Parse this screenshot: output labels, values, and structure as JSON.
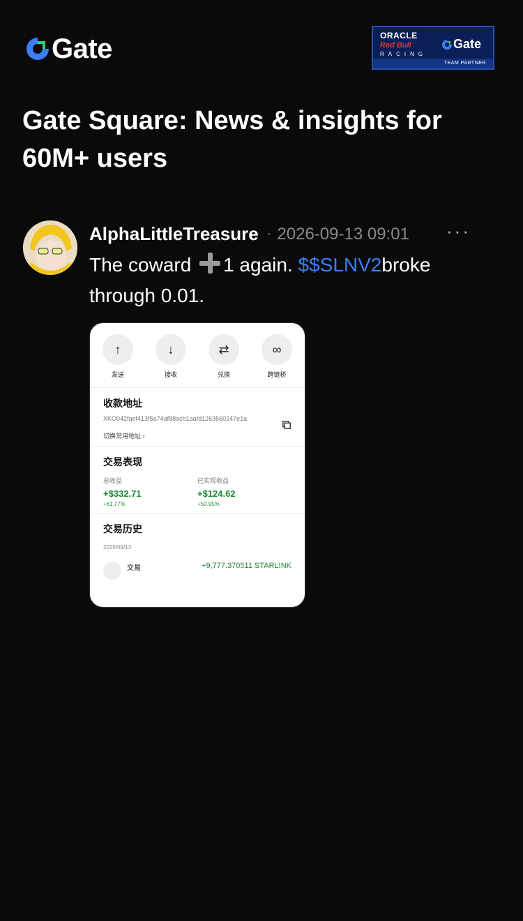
{
  "brand": {
    "name": "Gate",
    "accent": "#3a7ff6",
    "brand_green": "#2bd17a"
  },
  "partner_badge": {
    "line1": "ORACLE",
    "line2": "Red Bull",
    "line3": "RACING",
    "partner_name": "Gate",
    "footer": "TEAM PARTNER"
  },
  "headline": "Gate Square: News & insights for 60M+ users",
  "post": {
    "username": "AlphaLittleTreasure",
    "separator": "·",
    "timestamp": "2026-09-13 09:01",
    "more_label": "···",
    "text_before": "The coward",
    "text_after_icon": "1 again.",
    "ticker": "$$SLNV2",
    "text_end": "broke through 0.01.",
    "screenshot": {
      "actions": [
        {
          "icon": "↑",
          "label": "发送"
        },
        {
          "icon": "↓",
          "label": "接收"
        },
        {
          "icon": "⇄",
          "label": "兑换"
        },
        {
          "icon": "∞",
          "label": "跨链桥"
        }
      ],
      "address_section": {
        "title": "收款地址",
        "address": "XKO042faef413f5a74af88acb1aafd1263560247e1a",
        "switch_label": "切换常用地址 ›"
      },
      "performance": {
        "title": "交易表现",
        "total_label": "总收益",
        "total_value": "+$332.71",
        "total_pct": "+61.77%",
        "realized_label": "已实现收益",
        "realized_value": "+$124.62",
        "realized_pct": "+50.95%"
      },
      "history": {
        "title": "交易历史",
        "date": "2026/09/13",
        "tx_label": "交易",
        "tx_value": "+9,777.370511 STARLINK"
      }
    }
  }
}
